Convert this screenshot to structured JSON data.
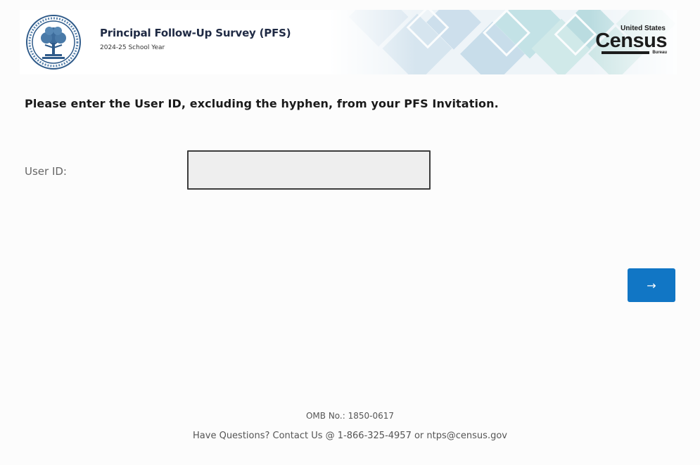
{
  "header": {
    "title": "Principal Follow-Up Survey (PFS)",
    "school_year": "2024-25 School Year",
    "seal_icon": "department-of-education-seal-icon",
    "census_logo": {
      "top": "United States",
      "main": "Census",
      "bottom": "Bureau"
    }
  },
  "form": {
    "instruction": "Please enter the User ID, excluding the hyphen, from your PFS Invitation.",
    "user_id_label": "User ID:",
    "user_id_value": "",
    "user_id_placeholder": "",
    "next_button_label": "→",
    "next_button_color": "#1176c5"
  },
  "footer": {
    "omb": "OMB No.: 1850-0617",
    "contact": "Have Questions? Contact Us @ 1-866-325-4957 or ntps@census.gov"
  }
}
